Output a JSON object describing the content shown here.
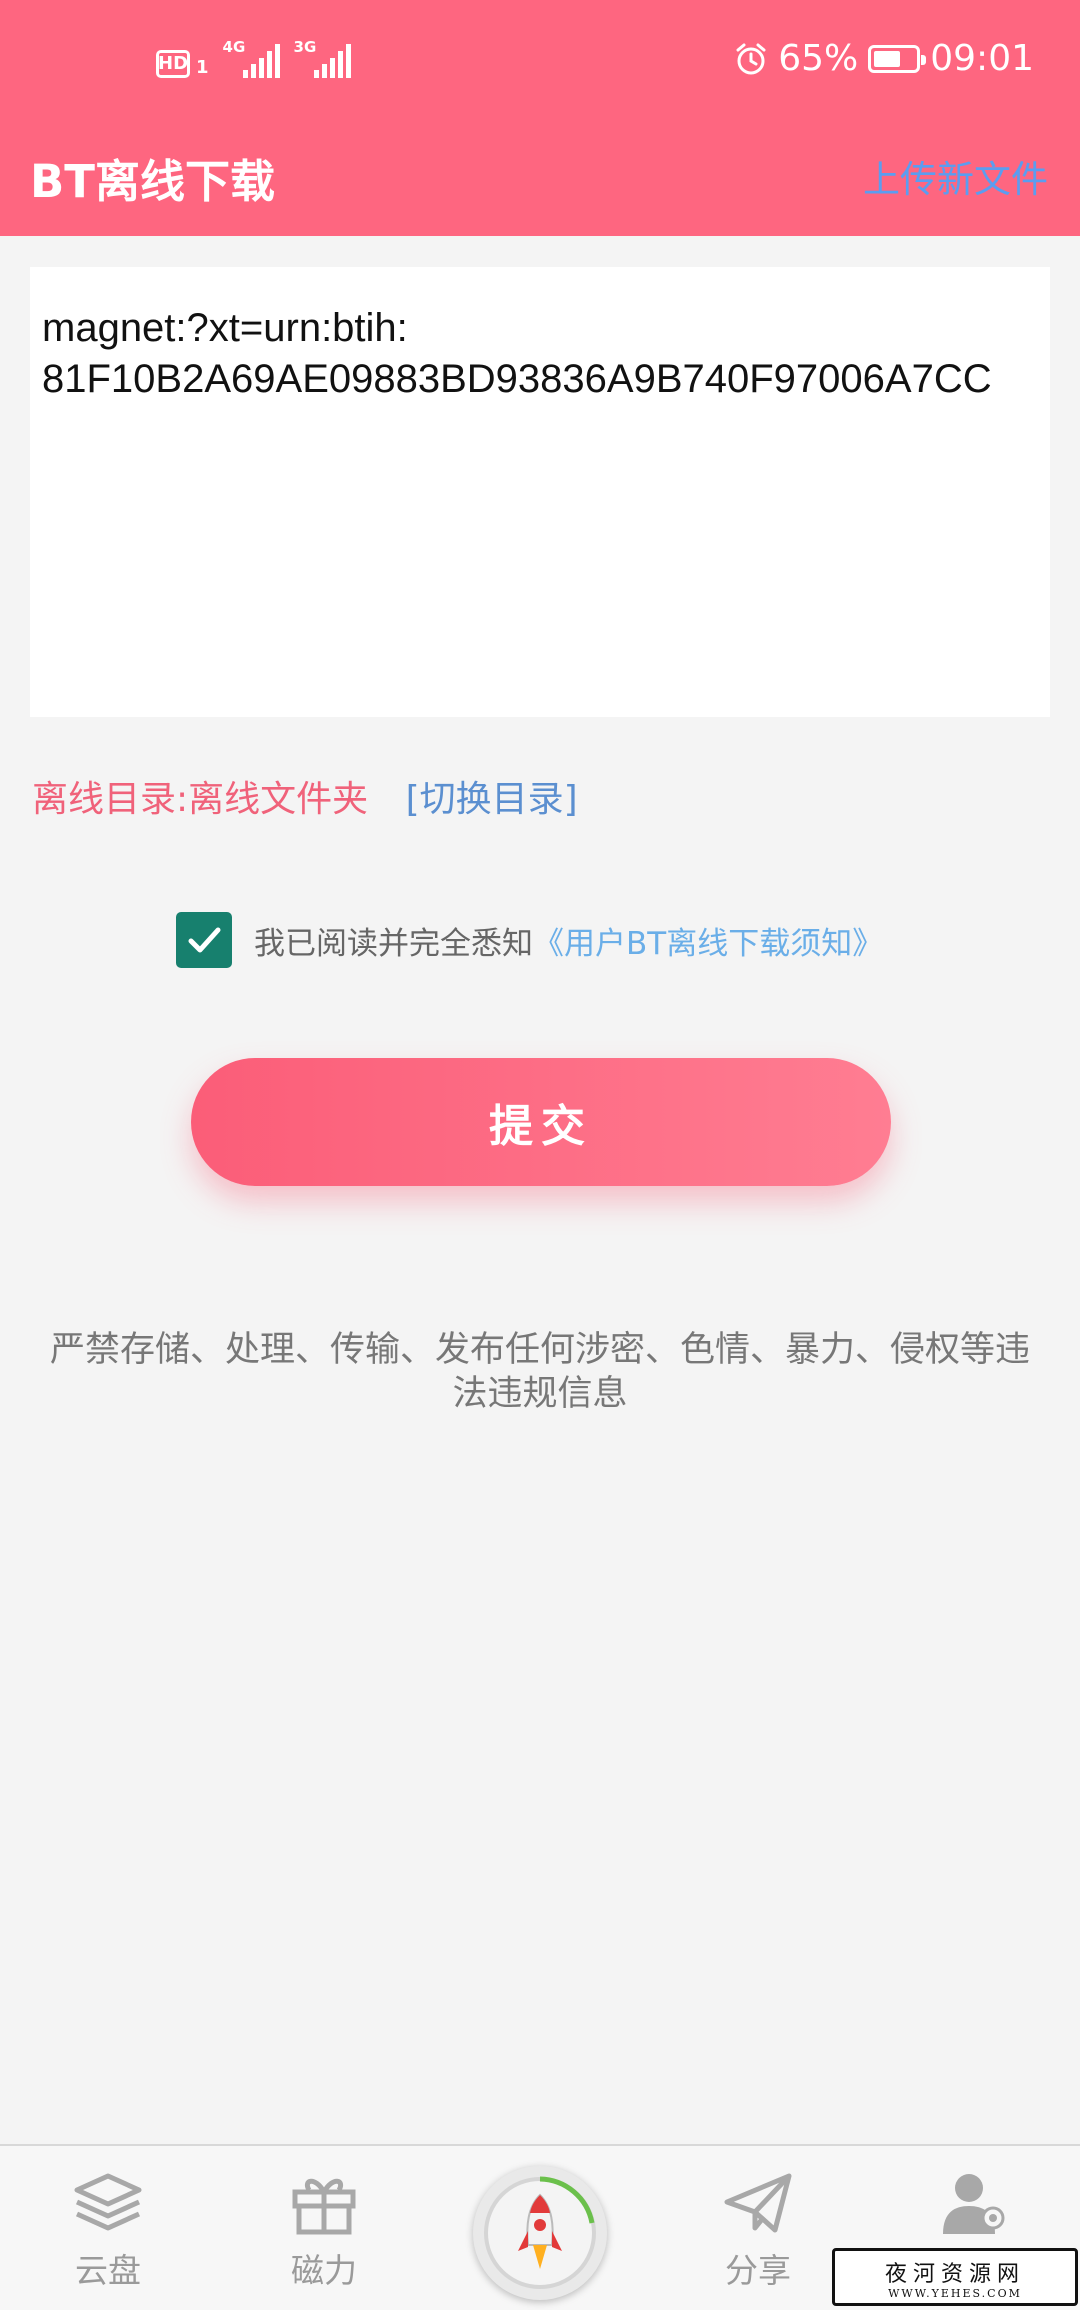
{
  "status_bar": {
    "hd_label": "HD",
    "sim_number": "1",
    "network_1": "4G",
    "network_2": "3G",
    "battery_percent": "65%",
    "battery_level": 0.65,
    "time": "09:01",
    "icons": [
      "hd-icon",
      "signal-icon",
      "alarm-icon",
      "battery-icon"
    ]
  },
  "app_bar": {
    "title": "BT离线下载",
    "upload_link": "上传新文件"
  },
  "magnet_input": {
    "value": "magnet:?xt=urn:btih:\n81F10B2A69AE09883BD93836A9B740F97006A7CC"
  },
  "directory": {
    "label": "离线目录:离线文件夹",
    "switch_link": "[切换目录]"
  },
  "agreement": {
    "checked": true,
    "text": "我已阅读并完全悉知",
    "link": "《用户BT离线下载须知》"
  },
  "submit_button": "提交",
  "notice": "严禁存储、处理、传输、发布任何涉密、色情、暴力、侵权等违法违规信息",
  "bottom_nav": {
    "items": [
      {
        "label": "云盘",
        "icon": "layers-icon"
      },
      {
        "label": "磁力",
        "icon": "gift-icon"
      },
      {
        "label": "",
        "icon": "rocket-icon"
      },
      {
        "label": "分享",
        "icon": "paper-plane-icon"
      },
      {
        "label": "",
        "icon": "user-badge-icon"
      }
    ]
  },
  "watermark": {
    "main": "夜河资源网",
    "sub": "WWW.YEHES.COM"
  },
  "colors": {
    "header": "#fe6680",
    "accent_blue": "#5b9df0",
    "checkbox": "#17806e",
    "directory_label": "#f0627a"
  }
}
